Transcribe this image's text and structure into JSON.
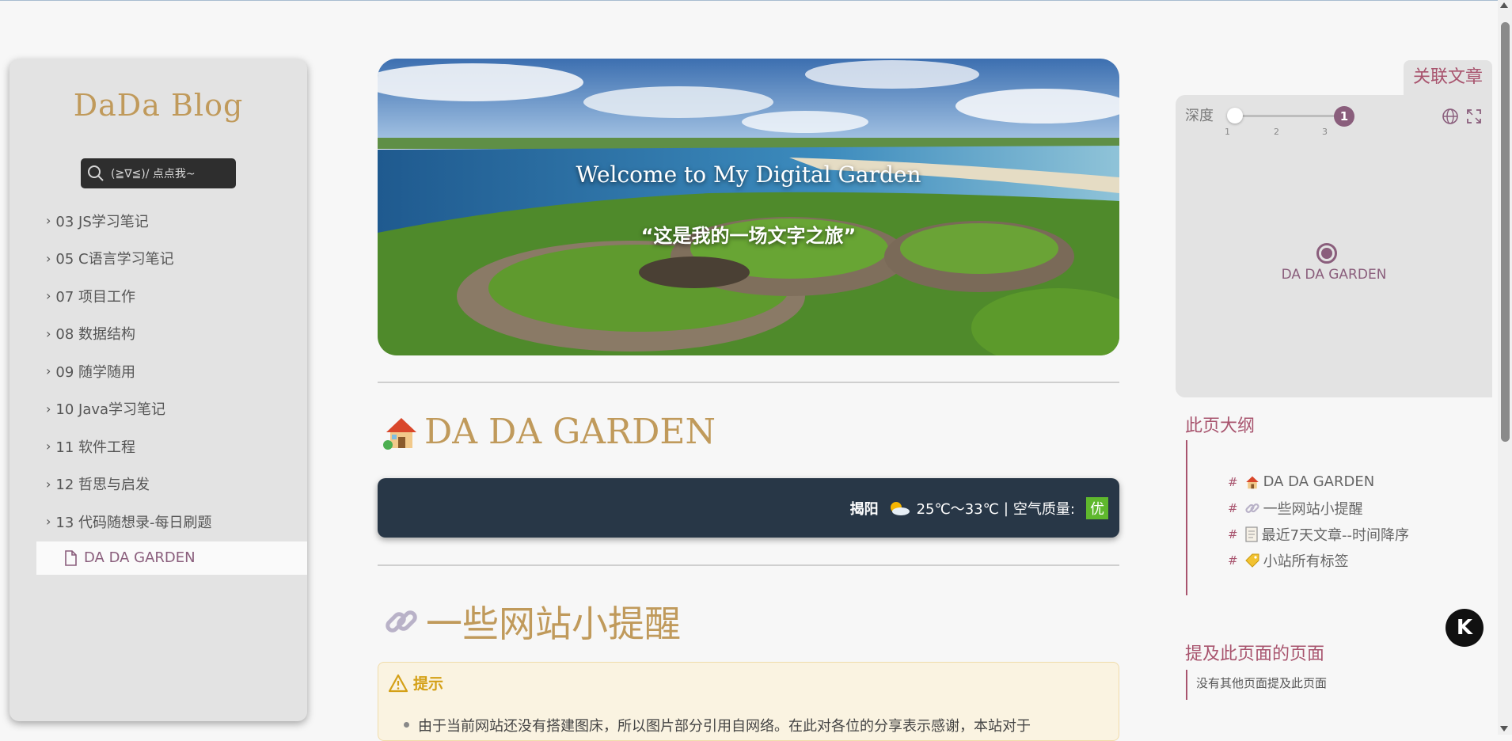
{
  "sidebar": {
    "brand": "DaDa Blog",
    "search_label": "(≧∇≦)/ 点点我~",
    "items": [
      {
        "label": "03 JS学习笔记"
      },
      {
        "label": "05 C语言学习笔记"
      },
      {
        "label": "07 项目工作"
      },
      {
        "label": "08 数据结构"
      },
      {
        "label": "09 随学随用"
      },
      {
        "label": "10 Java学习笔记"
      },
      {
        "label": "11 软件工程"
      },
      {
        "label": "12 哲思与启发"
      },
      {
        "label": "13 代码随想录-每日刷题"
      }
    ],
    "active_page": "DA DA GARDEN"
  },
  "hero": {
    "title": "Welcome to My Digital Garden",
    "subtitle": "“这是我的一场文字之旅”"
  },
  "main": {
    "heading": "DA DA GARDEN",
    "weather": {
      "city": "揭阳",
      "temp": "25℃～33℃",
      "separator": "|",
      "aqi_label": "空气质量:",
      "aqi_value": "优"
    },
    "section_heading": "一些网站小提醒",
    "callout": {
      "title": "提示",
      "text": "由于当前网站还没有搭建图床，所以图片部分引用自网络。在此对各位的分享表示感谢，本站对于"
    }
  },
  "graph": {
    "tab": "关联文章",
    "depth_label": "深度",
    "depth_value": "1",
    "ticks": [
      "1",
      "2",
      "3"
    ],
    "node_label": "DA DA GARDEN"
  },
  "toc": {
    "title": "此页大纲",
    "items": [
      {
        "label": "DA DA GARDEN"
      },
      {
        "label": "一些网站小提醒"
      },
      {
        "label": "最近7天文章--时间降序"
      },
      {
        "label": "小站所有标签"
      }
    ]
  },
  "backlinks": {
    "title": "提及此页面的页面",
    "empty_text": "没有其他页面提及此页面"
  },
  "badge": {
    "label": "K"
  },
  "colors": {
    "accent": "#8a5e7c",
    "heading_gold": "#c09a5b",
    "link_rose": "#a8546e",
    "weather_bg": "#283747"
  }
}
